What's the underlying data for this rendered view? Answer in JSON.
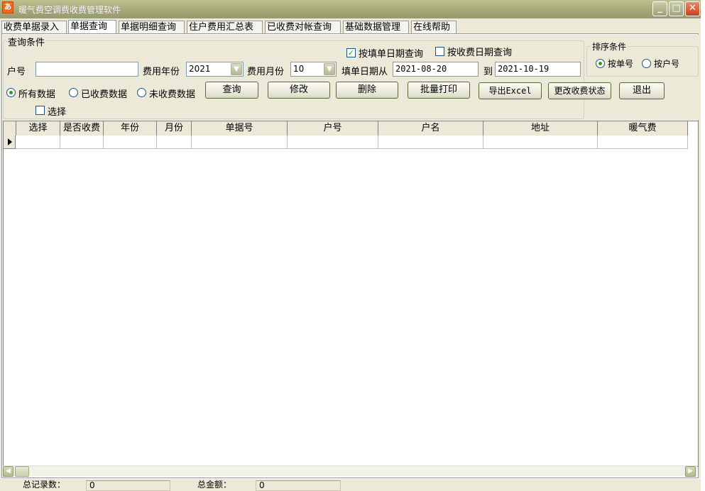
{
  "window": {
    "title": "暖气费空调费收费管理软件",
    "icon": "app-icon",
    "icon_glyph": "あ"
  },
  "titlebar_buttons": {
    "min": "_",
    "max": "□",
    "close": "✕"
  },
  "tabs": [
    {
      "label": "收费单据录入"
    },
    {
      "label": "单据查询"
    },
    {
      "label": "单据明细查询"
    },
    {
      "label": "住户费用汇总表"
    },
    {
      "label": "已收费对帐查询"
    },
    {
      "label": "基础数据管理"
    },
    {
      "label": "在线帮助"
    }
  ],
  "query": {
    "group_title": "查询条件",
    "household_label": "户号",
    "household_value": "",
    "year_label": "费用年份",
    "year_value": "2021",
    "month_label": "费用月份",
    "month_value": "10",
    "by_fill_date_label": "按填单日期查询",
    "by_fill_date_checked": true,
    "by_pay_date_label": "按收费日期查询",
    "by_pay_date_checked": false,
    "date_from_label": "填单日期从",
    "date_from": "2021-08-20",
    "date_to_label": "到",
    "date_to": "2021-10-19",
    "radio_all": "所有数据",
    "radio_paid": "已收费数据",
    "radio_unpaid": "未收费数据",
    "select_label": "选择"
  },
  "sort": {
    "group_title": "排序条件",
    "by_bill": "按单号",
    "by_household": "按户号"
  },
  "buttons": {
    "query": "查询",
    "edit": "修改",
    "delete": "删除",
    "batch_print": "批量打印",
    "export_excel": "导出Excel",
    "change_status": "更改收费状态",
    "exit": "退出"
  },
  "grid": {
    "columns": [
      "选择",
      "是否收费",
      "年份",
      "月份",
      "单据号",
      "户号",
      "户名",
      "地址",
      "暖气费"
    ]
  },
  "statusbar": {
    "total_records_label": "总记录数：",
    "total_records": "0",
    "total_amount_label": "总金额：",
    "total_amount": "0"
  },
  "colors": {
    "title_bar": "#a7a87a",
    "check_green": "#21a121",
    "close_red": "#c8401c"
  }
}
